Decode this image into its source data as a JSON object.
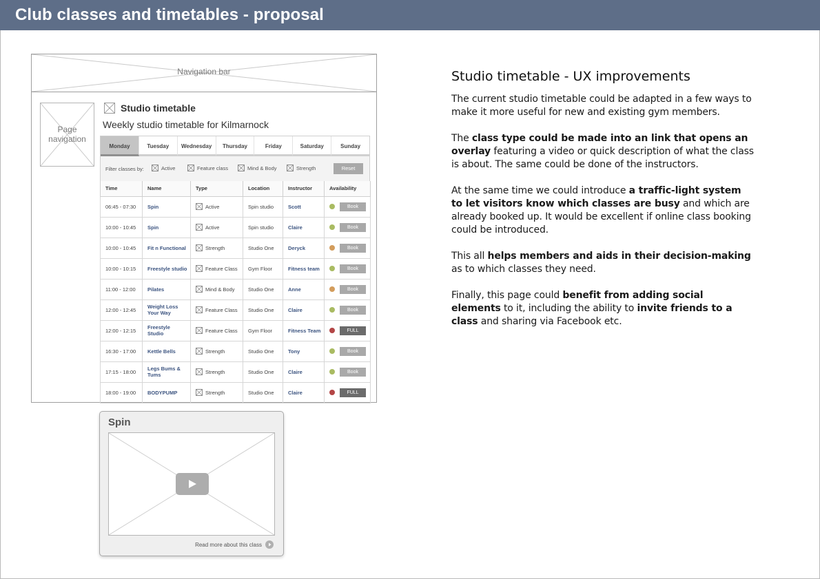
{
  "header": {
    "title": "Club classes and timetables - proposal"
  },
  "wireframe": {
    "navbar_label": "Navigation bar",
    "pagenav_label": "Page navigation",
    "section_title": "Studio timetable",
    "subtitle": "Weekly studio timetable for Kilmarnock",
    "days": [
      "Monday",
      "Tuesday",
      "Wednesday",
      "Thursday",
      "Friday",
      "Saturday",
      "Sunday"
    ],
    "filter": {
      "label": "Filter classes by:",
      "options": [
        "Active",
        "Feature class",
        "Mind & Body",
        "Strength"
      ],
      "reset_label": "Reset"
    },
    "columns": [
      "Time",
      "Name",
      "Type",
      "Location",
      "Instructor",
      "Availability"
    ],
    "rows": [
      {
        "time": "06:45 - 07:30",
        "name": "Spin",
        "type": "Active",
        "location": "Spin studio",
        "instructor": "Scott",
        "status": "green",
        "action": "Book"
      },
      {
        "time": "10:00 - 10:45",
        "name": "Spin",
        "type": "Active",
        "location": "Spin studio",
        "instructor": "Claire",
        "status": "green",
        "action": "Book"
      },
      {
        "time": "10:00 - 10:45",
        "name": "Fit n Functional",
        "type": "Strength",
        "location": "Studio One",
        "instructor": "Deryck",
        "status": "amber",
        "action": "Book"
      },
      {
        "time": "10:00 - 10:15",
        "name": "Freestyle studio",
        "type": "Feature Class",
        "location": "Gym Floor",
        "instructor": "Fitness team",
        "status": "green",
        "action": "Book"
      },
      {
        "time": "11:00 - 12:00",
        "name": "Pilates",
        "type": "Mind & Body",
        "location": "Studio One",
        "instructor": "Anne",
        "status": "amber",
        "action": "Book"
      },
      {
        "time": "12:00 - 12:45",
        "name": "Weight Loss Your Way",
        "type": "Feature Class",
        "location": "Studio One",
        "instructor": "Claire",
        "status": "green",
        "action": "Book"
      },
      {
        "time": "12:00 - 12:15",
        "name": "Freestyle Studio",
        "type": "Feature Class",
        "location": "Gym Floor",
        "instructor": "Fitness Team",
        "status": "red",
        "action": "FULL"
      },
      {
        "time": "16:30 - 17:00",
        "name": "Kettle Bells",
        "type": "Strength",
        "location": "Studio One",
        "instructor": "Tony",
        "status": "green",
        "action": "Book"
      },
      {
        "time": "17:15 - 18:00",
        "name": "Legs Bums & Tums",
        "type": "Strength",
        "location": "Studio One",
        "instructor": "Claire",
        "status": "green",
        "action": "Book"
      },
      {
        "time": "18:00 - 19:00",
        "name": "BODYPUMP",
        "type": "Strength",
        "location": "Studio One",
        "instructor": "Claire",
        "status": "red",
        "action": "FULL"
      }
    ],
    "status_colors": {
      "green": "#a9bb62",
      "amber": "#d39c5c",
      "red": "#b34646"
    }
  },
  "overlay": {
    "title": "Spin",
    "read_more": "Read more about this class",
    "icons": [
      "play-icon",
      "arrow-right-icon"
    ]
  },
  "notes": {
    "heading": "Studio timetable - UX improvements",
    "p1": "The current studio timetable could be adapted in a few ways to make it more useful for new and existing gym members.",
    "p2_a": "The ",
    "p2_b": "class type could be made into an link that opens an overlay",
    "p2_c": " featuring a video or quick description of what the class is about. The same could be done of the instructors.",
    "p3_a": "At the same time we could introduce ",
    "p3_b": "a traffic-light system to let visitors know which classes are busy",
    "p3_c": " and which are already booked up. It would be excellent if online class booking could be introduced.",
    "p4_a": "This all ",
    "p4_b": "helps members and aids in their decision-making",
    "p4_c": " as to which classes they need.",
    "p5_a": "Finally, this page could ",
    "p5_b": "benefit from adding social elements",
    "p5_c": " to it, including the ability to ",
    "p5_d": "invite friends to a class",
    "p5_e": " and sharing via Facebook etc."
  },
  "colors": {
    "header_bg": "#5e6e88",
    "link": "#3c5480"
  }
}
